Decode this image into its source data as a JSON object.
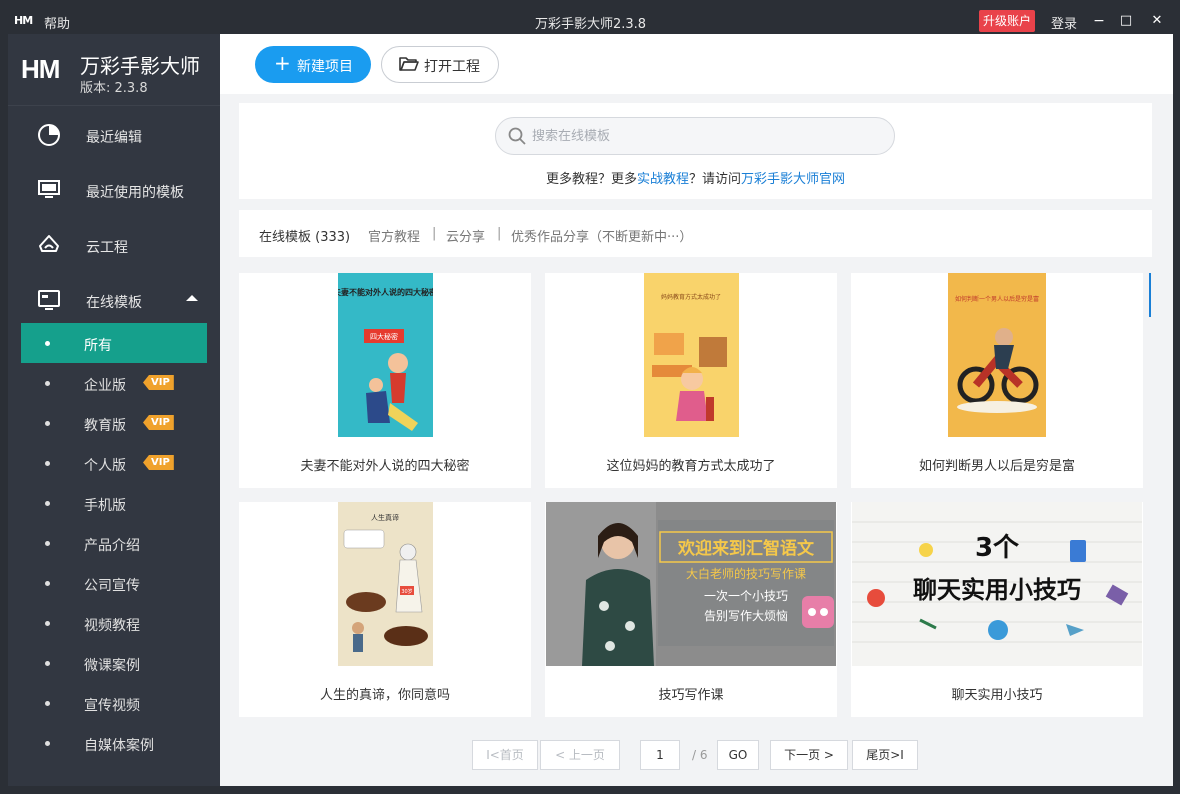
{
  "window": {
    "logo_small": "HM",
    "help": "帮助",
    "title": "万彩手影大师2.3.8",
    "upgrade": "升级账户",
    "login": "登录",
    "minimize": "−",
    "maximize": "□",
    "close": "✕"
  },
  "brand": {
    "logo": "HM",
    "name": "万彩手影大师",
    "version": "版本: 2.3.8"
  },
  "sidebar": {
    "main_items": [
      {
        "label": "最近编辑",
        "icon": "pie-chart-icon"
      },
      {
        "label": "最近使用的模板",
        "icon": "monitor-icon"
      },
      {
        "label": "云工程",
        "icon": "cloud-icon"
      },
      {
        "label": "在线模板",
        "icon": "screen-template-icon"
      }
    ],
    "sub_items": [
      {
        "label": "所有",
        "vip": false,
        "active": true
      },
      {
        "label": "企业版",
        "vip": true
      },
      {
        "label": "教育版",
        "vip": true
      },
      {
        "label": "个人版",
        "vip": true
      },
      {
        "label": "手机版",
        "vip": false
      },
      {
        "label": "产品介绍",
        "vip": false
      },
      {
        "label": "公司宣传",
        "vip": false
      },
      {
        "label": "视频教程",
        "vip": false
      },
      {
        "label": "微课案例",
        "vip": false
      },
      {
        "label": "宣传视频",
        "vip": false
      },
      {
        "label": "自媒体案例",
        "vip": false
      }
    ],
    "vip_badge": "VIP"
  },
  "toolbar": {
    "new_project": "新建项目",
    "open_project": "打开工程"
  },
  "search": {
    "placeholder": "搜索在线模板",
    "promo_prefix": "更多教程？更多",
    "promo_link1": "实战教程",
    "promo_middle": "？请访问",
    "promo_link2": "万彩手影大师官网"
  },
  "tabs": {
    "items": [
      "在线模板 (333)",
      "官方教程",
      "云分享",
      "优秀作品分享（不断更新中···）"
    ],
    "separator": "|"
  },
  "templates": [
    {
      "caption": "夫妻不能对外人说的四大秘密",
      "poster_title": "夫妻不能对外人说的四大秘密",
      "poster_tag": "四大秘密"
    },
    {
      "caption": "这位妈妈的教育方式太成功了",
      "poster_title": "妈妈教育方式太成功了"
    },
    {
      "caption": "如何判断男人以后是穷是富",
      "poster_title": "如何判断一个男人以后是穷是富"
    },
    {
      "caption": "人生的真谛，你同意吗",
      "poster_title": "人生真谛",
      "poster_tag": "30岁"
    },
    {
      "caption": "技巧写作课",
      "poster_title": "欢迎来到汇智语文",
      "poster_sub": "大白老师的技巧写作课",
      "poster_line3": "一次一个小技巧",
      "poster_line4": "告别写作大烦恼"
    },
    {
      "caption": "聊天实用小技巧",
      "poster_title": "3个",
      "poster_sub": "聊天实用小技巧"
    }
  ],
  "pager": {
    "first": "I<首页",
    "prev": "< 上一页",
    "current": "1",
    "total": "/ 6",
    "go": "GO",
    "next": "下一页 >",
    "last": "尾页>I"
  },
  "colors": {
    "accent": "#1a9cf0",
    "active_nav": "#15a08c",
    "upgrade": "#e9424a",
    "vip": "#f0a22c",
    "sidebar_bg": "#323741",
    "link": "#1a7fd6"
  }
}
